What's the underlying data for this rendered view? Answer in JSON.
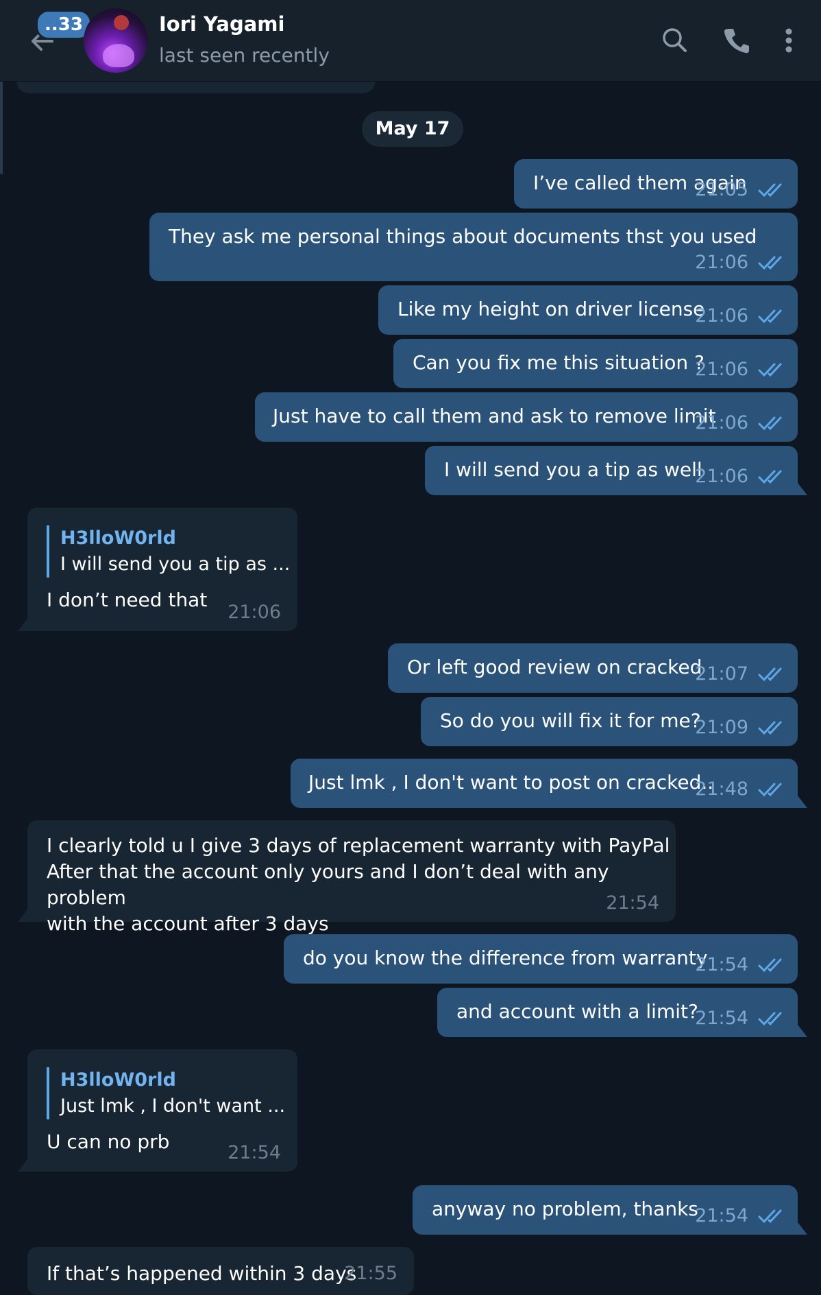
{
  "header": {
    "unread_count": "..33",
    "contact_name": "Iori Yagami",
    "status": "last seen recently"
  },
  "date_separator": "May 17",
  "messages": [
    {
      "text": "I’ve called them again",
      "time": "21:05"
    },
    {
      "text": "They ask me personal things about documents thst you used",
      "time": "21:06"
    },
    {
      "text": "Like my height on driver license",
      "time": "21:06"
    },
    {
      "text": "Can you fix me this situation ?",
      "time": "21:06"
    },
    {
      "text": "Just have to call them and ask to remove limit",
      "time": "21:06"
    },
    {
      "text": "I will send you a tip as well",
      "time": "21:06"
    },
    {
      "reply_name": "H3lloW0rld",
      "reply_text": "I will send you a tip as ...",
      "text": "I don’t need that",
      "time": "21:06"
    },
    {
      "text": "Or left good review on cracked",
      "time": "21:07"
    },
    {
      "text": "So do you will fix it for me?",
      "time": "21:09"
    },
    {
      "text": "Just lmk , I don't want to post on cracked..",
      "time": "21:48"
    },
    {
      "text": "I clearly told u I give 3 days of replacement warranty with PayPal\nAfter that the account only yours and I don’t deal with any problem\nwith the account after 3 days",
      "time": "21:54"
    },
    {
      "text": "do you know the difference from warranty",
      "time": "21:54"
    },
    {
      "text": "and account with a limit?",
      "time": "21:54"
    },
    {
      "reply_name": "H3lloW0rld",
      "reply_text": "Just lmk , I don't want ...",
      "text": "U can no prb",
      "time": "21:54"
    },
    {
      "text": "anyway no problem, thanks",
      "time": "21:54"
    },
    {
      "text": "If that’s happened within 3 days",
      "time": "21:55"
    }
  ],
  "colors": {
    "background": "#0e1621",
    "header": "#17212b",
    "outgoing_bubble": "#2b5278",
    "incoming_bubble": "#182533",
    "accent": "#5ea8e8"
  }
}
